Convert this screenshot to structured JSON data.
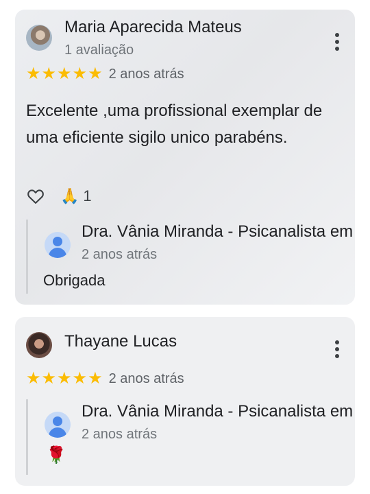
{
  "reviews": [
    {
      "author": "Maria Aparecida Mateus",
      "meta": "1 avaliação",
      "stars": "★★★★★",
      "when": "2 anos atrás",
      "text": "Excelente ,uma profissional exemplar de uma eficiente sigilo unico parabéns.",
      "reaction_emoji": "🙏",
      "reaction_count": "1",
      "reply": {
        "owner": "Dra. Vânia Miranda - Psicanalista em",
        "when": "2 anos atrás",
        "text": "Obrigada"
      }
    },
    {
      "author": "Thayane Lucas",
      "stars": "★★★★★",
      "when": "2 anos atrás",
      "reply": {
        "owner": "Dra. Vânia Miranda - Psicanalista em",
        "when": "2 anos atrás",
        "text": "🌹"
      }
    }
  ],
  "colors": {
    "star": "#fbbc04",
    "card": "#eeeff1",
    "accent": "#4a86e8"
  }
}
